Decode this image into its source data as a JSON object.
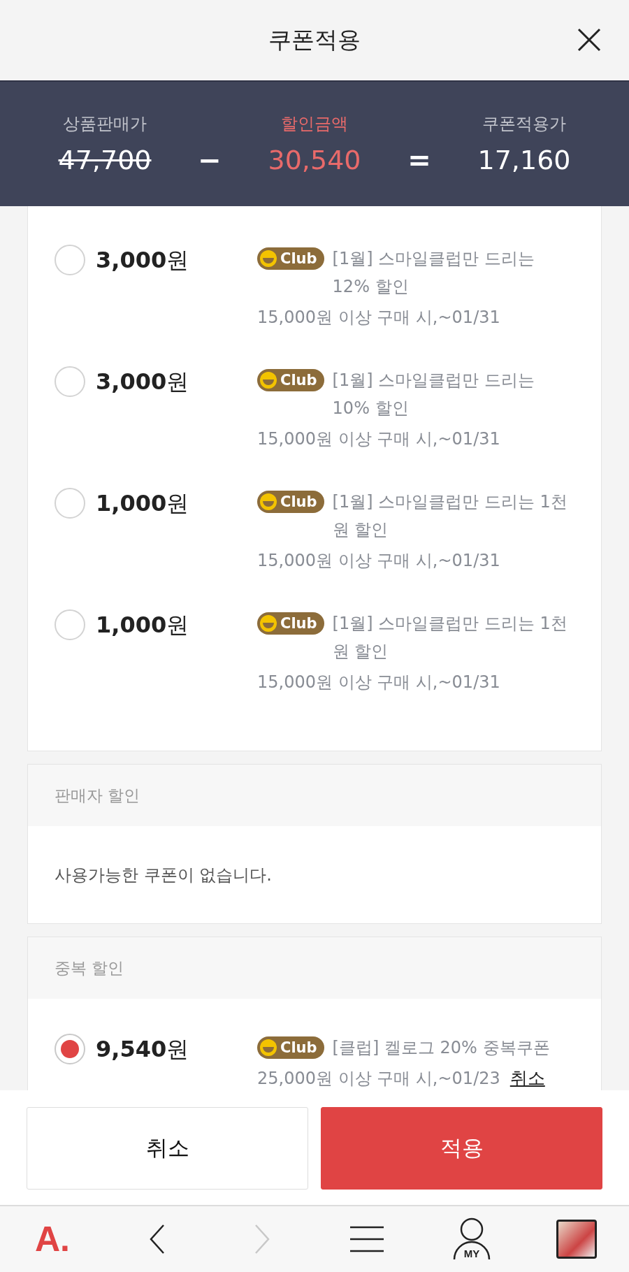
{
  "header": {
    "title": "쿠폰적용"
  },
  "summary": {
    "items": [
      {
        "kind": "original",
        "label": "상품판매가",
        "value": "47,700"
      },
      {
        "kind": "operator",
        "value": "−"
      },
      {
        "kind": "discount",
        "label": "할인금액",
        "value": "30,540"
      },
      {
        "kind": "operator",
        "value": "="
      },
      {
        "kind": "final",
        "label": "쿠폰적용가",
        "value": "17,160"
      }
    ]
  },
  "sections": [
    {
      "coupons": [
        {
          "amount": "**3,000**원",
          "badge": "Club",
          "title": "[1월] 스마일클럽만 드리는 12% 할인",
          "condition": "15,000원 이상 구매 시,~01/31",
          "selected": false
        },
        {
          "amount": "**3,000**원",
          "badge": "Club",
          "title": "[1월] 스마일클럽만 드리는 10% 할인",
          "condition": "15,000원 이상 구매 시,~01/31",
          "selected": false
        },
        {
          "amount": "**1,000**원",
          "badge": "Club",
          "title": "[1월] 스마일클럽만 드리는 1천원 할인",
          "condition": "15,000원 이상 구매 시,~01/31",
          "selected": false
        },
        {
          "amount": "**1,000**원",
          "badge": "Club",
          "title": "[1월] 스마일클럽만 드리는 1천원 할인",
          "condition": "15,000원 이상 구매 시,~01/31",
          "selected": false
        }
      ]
    },
    {
      "title": "판매자 할인",
      "empty_message": "사용가능한 쿠폰이 없습니다."
    },
    {
      "title": "중복 할인",
      "coupons": [
        {
          "amount": "**9,540**원",
          "badge": "Club",
          "title": "[클럽] 켈로그 20% 중복쿠폰",
          "condition": "25,000원 이상 구매 시,~01/23",
          "cancel_link": "취소",
          "selected": true
        }
      ]
    }
  ],
  "buttons": [
    {
      "kind": "cancel",
      "label": "취소"
    },
    {
      "kind": "apply",
      "label": "적용"
    }
  ],
  "nav": [
    {
      "kind": "logo",
      "text": "A.",
      "disabled": false
    },
    {
      "kind": "back",
      "disabled": false
    },
    {
      "kind": "forward",
      "disabled": true
    },
    {
      "kind": "menu",
      "disabled": false
    },
    {
      "kind": "my",
      "text": "MY",
      "disabled": false
    },
    {
      "kind": "recent",
      "disabled": false
    }
  ]
}
